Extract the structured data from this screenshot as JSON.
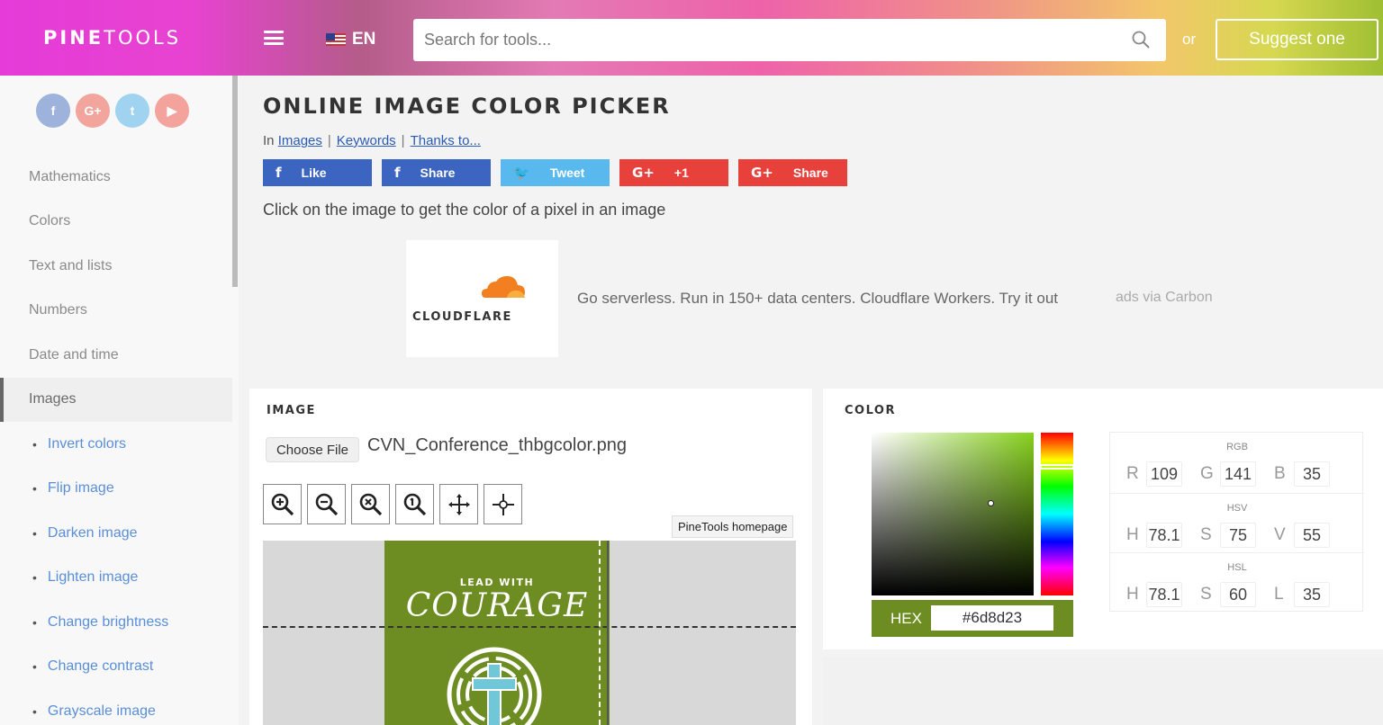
{
  "header": {
    "logo_bold": "PINE",
    "logo_thin": "TOOLS",
    "language": "EN",
    "search_placeholder": "Search for tools...",
    "or": "or",
    "suggest_label": "Suggest one"
  },
  "sidebar": {
    "socials": [
      {
        "label": "f",
        "icon": "facebook-icon"
      },
      {
        "label": "G+",
        "icon": "google-plus-icon"
      },
      {
        "label": "t",
        "icon": "twitter-icon"
      },
      {
        "label": "▶",
        "icon": "youtube-icon"
      }
    ],
    "categories": [
      "Mathematics",
      "Colors",
      "Text and lists",
      "Numbers",
      "Date and time",
      "Images"
    ],
    "subitems": [
      "Invert colors",
      "Flip image",
      "Darken image",
      "Lighten image",
      "Change brightness",
      "Change contrast",
      "Grayscale image"
    ]
  },
  "page": {
    "title": "ONLINE IMAGE COLOR PICKER",
    "breadcrumb_prefix": "In",
    "breadcrumbs": [
      "Images",
      "Keywords",
      "Thanks to..."
    ],
    "share_buttons": [
      {
        "glyph": "f",
        "label": "Like"
      },
      {
        "glyph": "f",
        "label": "Share"
      },
      {
        "glyph": "🐦",
        "label": "Tweet"
      },
      {
        "glyph": "G+",
        "label": "+1"
      },
      {
        "glyph": "G+",
        "label": "Share"
      }
    ],
    "instructions": "Click on the image to get the color of a pixel in an image"
  },
  "ad": {
    "logo_word": "CLOUDFLARE",
    "text": "Go serverless. Run in 150+ data centers. Cloudflare Workers. Try it out",
    "via": "ads via Carbon"
  },
  "image_panel": {
    "heading": "IMAGE",
    "choose_file": "Choose File",
    "file_name": "CVN_Conference_thbgcolor.png",
    "tooltip": "PineTools homepage",
    "image_lead": "LEAD WITH",
    "image_word": "COURAGE"
  },
  "color_panel": {
    "heading": "COLOR",
    "hex_label": "HEX",
    "hex_value": "#6d8d23",
    "accent": "#6d8d23",
    "rgb": {
      "title": "RGB",
      "labels": [
        "R",
        "G",
        "B"
      ],
      "values": [
        "109",
        "141",
        "35"
      ]
    },
    "hsv": {
      "title": "HSV",
      "labels": [
        "H",
        "S",
        "V"
      ],
      "values": [
        "78.1",
        "75",
        "55"
      ]
    },
    "hsl": {
      "title": "HSL",
      "labels": [
        "H",
        "S",
        "L"
      ],
      "values": [
        "78.1",
        "60",
        "35"
      ]
    }
  }
}
